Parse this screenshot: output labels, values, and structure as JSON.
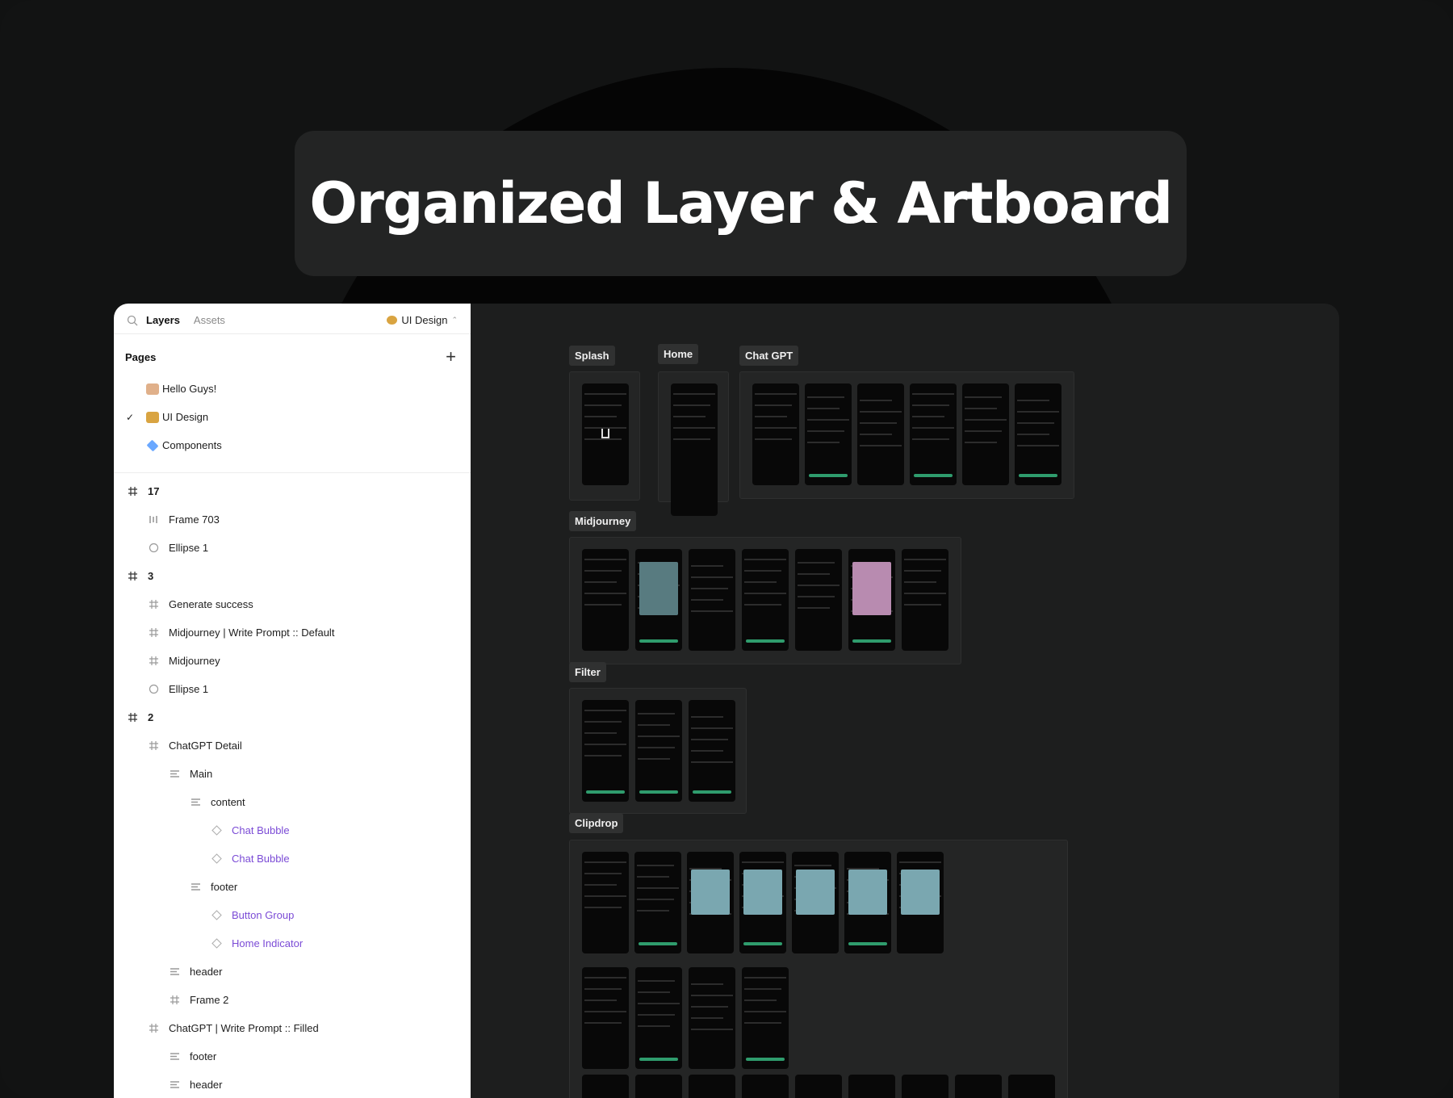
{
  "headline": "Organized Layer & Artboard",
  "panel": {
    "tabs": {
      "layers": "Layers",
      "assets": "Assets"
    },
    "current_page": "UI Design",
    "pages_title": "Pages",
    "pages": [
      {
        "label": "Hello Guys!",
        "checked": false,
        "icon": "person-emoji"
      },
      {
        "label": "UI Design",
        "checked": true,
        "icon": "palette-emoji"
      },
      {
        "label": "Components",
        "checked": false,
        "icon": "components-icon"
      }
    ],
    "layers": [
      {
        "label": "17",
        "type": "frame",
        "level": 0,
        "top": true
      },
      {
        "label": "Frame 703",
        "type": "autolayout-h",
        "level": 1
      },
      {
        "label": "Ellipse 1",
        "type": "ellipse",
        "level": 1
      },
      {
        "label": "3",
        "type": "frame",
        "level": 0,
        "top": true
      },
      {
        "label": "Generate success",
        "type": "frame",
        "level": 1
      },
      {
        "label": "Midjourney | Write Prompt :: Default",
        "type": "frame",
        "level": 1
      },
      {
        "label": "Midjourney",
        "type": "frame",
        "level": 1
      },
      {
        "label": "Ellipse 1",
        "type": "ellipse",
        "level": 1
      },
      {
        "label": "2",
        "type": "frame",
        "level": 0,
        "top": true
      },
      {
        "label": "ChatGPT Detail",
        "type": "frame",
        "level": 1
      },
      {
        "label": "Main",
        "type": "autolayout-v",
        "level": 2
      },
      {
        "label": "content",
        "type": "autolayout-v",
        "level": 3
      },
      {
        "label": "Chat Bubble",
        "type": "instance",
        "level": 4
      },
      {
        "label": "Chat Bubble",
        "type": "instance",
        "level": 4
      },
      {
        "label": "footer",
        "type": "autolayout-v",
        "level": 3
      },
      {
        "label": "Button Group",
        "type": "instance",
        "level": 4
      },
      {
        "label": "Home Indicator",
        "type": "instance",
        "level": 4
      },
      {
        "label": "header",
        "type": "autolayout-v",
        "level": 2
      },
      {
        "label": "Frame 2",
        "type": "frame",
        "level": 2
      },
      {
        "label": "ChatGPT | Write Prompt :: Filled",
        "type": "frame",
        "level": 1
      },
      {
        "label": "footer",
        "type": "autolayout-v",
        "level": 2
      },
      {
        "label": "header",
        "type": "autolayout-v",
        "level": 2
      }
    ]
  },
  "canvas": {
    "sections": [
      {
        "id": "splash",
        "label": "Splash",
        "screens": 1
      },
      {
        "id": "home",
        "label": "Home",
        "screens": 1
      },
      {
        "id": "chatgpt",
        "label": "Chat GPT",
        "screens": 6
      },
      {
        "id": "midjourney",
        "label": "Midjourney",
        "screens": 7
      },
      {
        "id": "filter",
        "label": "Filter",
        "screens": 3
      },
      {
        "id": "clipdrop",
        "label": "Clipdrop",
        "screens": 23
      }
    ],
    "colors": {
      "accent": "#2f9c6d",
      "canvas_bg": "#1d1e1e",
      "screen_bg": "#080808"
    }
  }
}
